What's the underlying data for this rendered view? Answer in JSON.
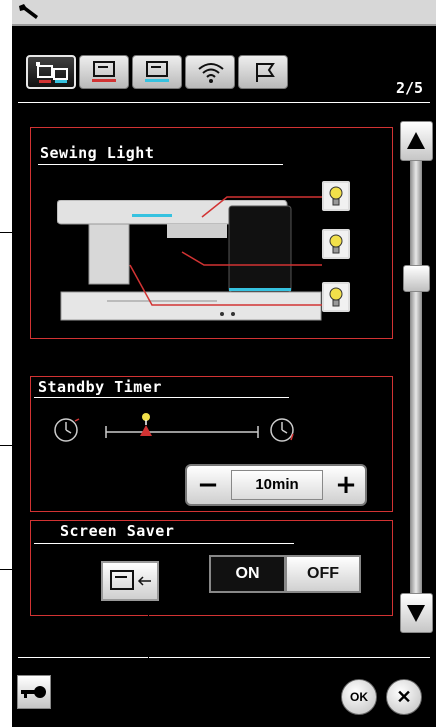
{
  "page_indicator": "2/5",
  "tabs": [
    {
      "icon": "machine-settings-icon",
      "active": true
    },
    {
      "icon": "sewing-settings-icon",
      "active": false
    },
    {
      "icon": "embroidery-settings-icon",
      "active": false
    },
    {
      "icon": "wireless-icon",
      "active": false
    },
    {
      "icon": "language-flag-icon",
      "active": false
    }
  ],
  "sewing_light": {
    "title": "Sewing Light",
    "bulbs": [
      "top-light",
      "middle-light",
      "bottom-light"
    ]
  },
  "standby_timer": {
    "title": "Standby Timer",
    "value": "10min",
    "minus": "−",
    "plus": "+"
  },
  "screen_saver": {
    "title": "Screen Saver",
    "on_label": "ON",
    "off_label": "OFF",
    "selected": "ON"
  },
  "footer": {
    "ok_label": "OK",
    "close_label": "✕"
  },
  "colors": {
    "panel": "#000000",
    "section_border": "#d23333",
    "accent_cyan": "#36c2e0",
    "accent_red": "#d23333",
    "bulb_yellow": "#f2e04a"
  }
}
